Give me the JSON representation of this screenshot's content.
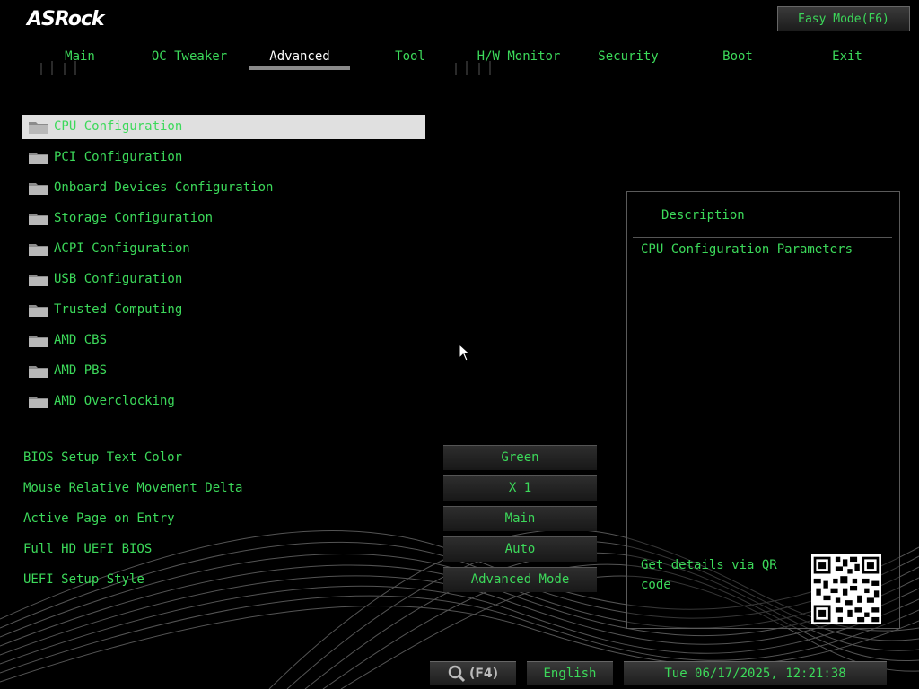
{
  "brand": {
    "logo_text": "ASRock"
  },
  "header": {
    "easy_mode_label": "Easy Mode(F6)"
  },
  "tabs": [
    {
      "label": "Main",
      "active": false
    },
    {
      "label": "OC Tweaker",
      "active": false
    },
    {
      "label": "Advanced",
      "active": true
    },
    {
      "label": "Tool",
      "active": false
    },
    {
      "label": "H/W Monitor",
      "active": false
    },
    {
      "label": "Security",
      "active": false
    },
    {
      "label": "Boot",
      "active": false
    },
    {
      "label": "Exit",
      "active": false
    }
  ],
  "menu": {
    "items": [
      {
        "label": "CPU Configuration",
        "selected": true
      },
      {
        "label": "PCI Configuration",
        "selected": false
      },
      {
        "label": "Onboard Devices Configuration",
        "selected": false
      },
      {
        "label": "Storage Configuration",
        "selected": false
      },
      {
        "label": "ACPI Configuration",
        "selected": false
      },
      {
        "label": "USB Configuration",
        "selected": false
      },
      {
        "label": "Trusted Computing",
        "selected": false
      },
      {
        "label": "AMD CBS",
        "selected": false
      },
      {
        "label": "AMD PBS",
        "selected": false
      },
      {
        "label": "AMD Overclocking",
        "selected": false
      }
    ],
    "icon": "folder-icon"
  },
  "settings": [
    {
      "label": "BIOS Setup Text Color",
      "value": "Green"
    },
    {
      "label": "Mouse Relative Movement Delta",
      "value": "X 1"
    },
    {
      "label": "Active Page on Entry",
      "value": "Main"
    },
    {
      "label": "Full HD UEFI BIOS",
      "value": "Auto"
    },
    {
      "label": "UEFI Setup Style",
      "value": "Advanced Mode"
    }
  ],
  "description": {
    "title": "Description",
    "text": "CPU Configuration Parameters",
    "qr_text": "Get details via QR code"
  },
  "footer": {
    "search_label": "(F4)",
    "language": "English",
    "datetime": "Tue 06/17/2025, 12:21:38"
  },
  "colors": {
    "text_green": "#3cd95a",
    "selected_bg": "#e0e0e0",
    "background": "#000000"
  }
}
